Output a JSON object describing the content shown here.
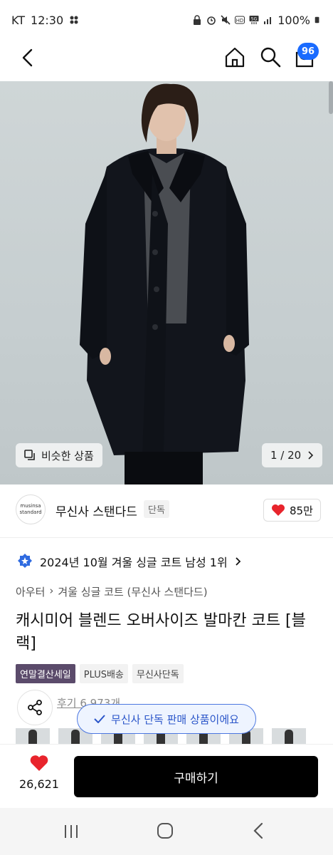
{
  "status_bar": {
    "carrier": "KT",
    "time": "12:30",
    "battery": "100%"
  },
  "header": {
    "cart_count": "96"
  },
  "gallery": {
    "similar_label": "비슷한 상품",
    "counter": "1 / 20"
  },
  "brand": {
    "logo_line1": "musinsa",
    "logo_line2": "standard",
    "name": "무신사 스탠다드",
    "exclusive_tag": "단독",
    "likes": "85만"
  },
  "ranking": {
    "text": "2024년 10월 겨울 싱글 코트 남성 1위"
  },
  "category": {
    "parent": "아우터",
    "child": "겨울 싱글 코트 (무신사 스탠다드)"
  },
  "product": {
    "title": "캐시미어 블렌드 오버사이즈 발마칸 코트 [블랙]",
    "tags": [
      "연말결산세일",
      "PLUS배송",
      "무신사단독"
    ]
  },
  "reviews": {
    "label": "후기 6,973개"
  },
  "toast": {
    "text": "무신사 단독 판매 상품이에요"
  },
  "bottom_bar": {
    "wish_count": "26,621",
    "buy_label": "구매하기"
  },
  "colors": {
    "accent_blue": "#1a6bff",
    "heart_red": "#e8242c",
    "sale_tag": "#5b4b6b",
    "buy_button": "#000000"
  }
}
